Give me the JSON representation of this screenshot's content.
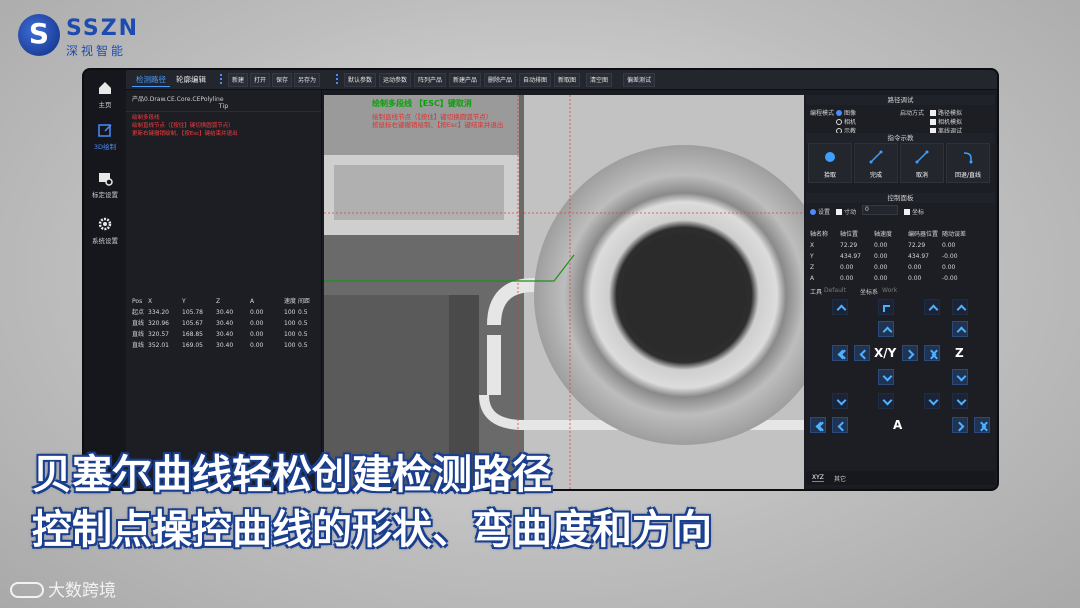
{
  "brand": {
    "name": "SSZN",
    "subtitle": "深视智能"
  },
  "sidebar": {
    "items": [
      {
        "label": "主页",
        "icon": "home-icon"
      },
      {
        "label": "3D绘制",
        "icon": "edit-icon",
        "active": true
      },
      {
        "label": "标定设置",
        "icon": "calibration-icon"
      },
      {
        "label": "系统设置",
        "icon": "gear-icon"
      }
    ]
  },
  "toolbar": {
    "tabs": [
      "检测路径",
      "轮廓编辑"
    ],
    "file_buttons": [
      "新建",
      "打开",
      "保存",
      "另存为"
    ],
    "action_buttons": [
      "默认参数",
      "运动参数",
      "阵列产品",
      "新建产品",
      "删除产品",
      "自动排图",
      "新取图",
      "清空图",
      "偏差测试"
    ]
  },
  "left_panel": {
    "path": "产品0.Draw.CE.Core.CEPolyline",
    "tip_label": "Tip",
    "messages": [
      "绘制多段线",
      "绘制直线节点（【按住】键切换圆弧节点）",
      "更新右键撤销绘制、【按Esc】键结束并退出"
    ],
    "table": {
      "headers": [
        "Pos",
        "X",
        "Y",
        "Z",
        "A",
        "速度",
        "间距"
      ],
      "rows": [
        [
          "起点",
          "334.20",
          "105.78",
          "30.40",
          "0.00",
          "100",
          "0.5"
        ],
        [
          "直线",
          "320.96",
          "105.67",
          "30.40",
          "0.00",
          "100",
          "0.5"
        ],
        [
          "直线",
          "320.57",
          "168.85",
          "30.40",
          "0.00",
          "100",
          "0.5"
        ],
        [
          "直线",
          "352.01",
          "169.05",
          "30.40",
          "0.00",
          "100",
          "0.5"
        ]
      ]
    }
  },
  "camera": {
    "title": "绘制多段线 【ESC】键取消",
    "lines": [
      "绘制直线节点（【按住】键切换圆弧节点）",
      "按鼠标右键撤销绘制、【按Esc】键结束并退出"
    ],
    "colors": {
      "path": "#1f8f1f",
      "crosshair": "#e04040"
    }
  },
  "right_panel": {
    "path_test_header": "路径调试",
    "mode_label": "编程模式",
    "mode_options": [
      "图像",
      "相机",
      "示教"
    ],
    "start_label": "启动方式",
    "start_options": [
      "路径模拟",
      "相机模拟",
      "离线调试"
    ],
    "command_header": "指令示教",
    "commands": [
      {
        "label": "拾取",
        "icon": "dot-icon"
      },
      {
        "label": "完成",
        "icon": "line-icon"
      },
      {
        "label": "取消",
        "icon": "line-icon"
      },
      {
        "label": "回退/直线",
        "icon": "undo-icon"
      }
    ],
    "control_header": "控制面板",
    "control_set": "设置",
    "control_step": "寸动",
    "control_step_value": "0",
    "control_coord": "坐标",
    "axis_table": {
      "headers": [
        "轴名称",
        "轴位置",
        "轴速度",
        "编码器位置",
        "随动误差"
      ],
      "rows": [
        [
          "X",
          "72.29",
          "0.00",
          "72.29",
          "0.00"
        ],
        [
          "Y",
          "434.97",
          "0.00",
          "434.97",
          "-0.00"
        ],
        [
          "Z",
          "0.00",
          "0.00",
          "0.00",
          "0.00"
        ],
        [
          "A",
          "0.00",
          "0.00",
          "0.00",
          "-0.00"
        ]
      ]
    },
    "tool_label": "工具",
    "tool_value": "Default",
    "coord_label": "坐标系",
    "coord_value": "Work",
    "jog_labels": {
      "xy": "X/Y",
      "z": "Z",
      "a": "A"
    },
    "bottom_tabs": [
      "XYZ",
      "其它"
    ]
  },
  "captions": {
    "line1": "贝塞尔曲线轻松创建检测路径",
    "line2": "控制点操控曲线的形状、弯曲度和方向"
  },
  "watermark": "大数跨境"
}
